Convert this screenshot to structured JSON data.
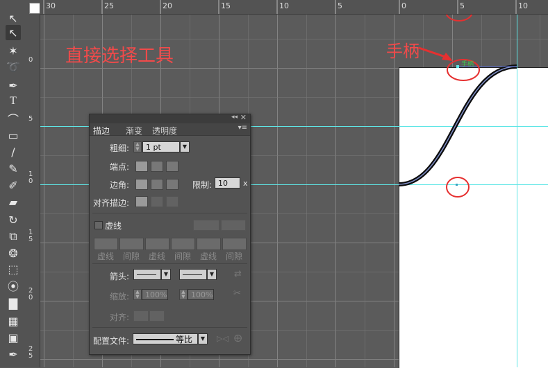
{
  "ruler": {
    "h_numbers": [
      "30",
      "25",
      "20",
      "15",
      "10",
      "5",
      "0",
      "5",
      "10"
    ],
    "v_numbers": [
      "0",
      "5",
      "1 0",
      "1 5",
      "2 0",
      "2 5"
    ]
  },
  "annotations": {
    "direct_select": "直接选择工具",
    "handle": "手柄",
    "handle_small": "手柄"
  },
  "stroke_panel": {
    "tabs": [
      "描边",
      "渐变",
      "透明度"
    ],
    "weight_label": "粗细:",
    "weight_value": "1 pt",
    "cap_label": "端点:",
    "corner_label": "边角:",
    "limit_label": "限制:",
    "limit_value": "10",
    "limit_unit": "x",
    "align_label": "对齐描边:",
    "dashed_label": "虚线",
    "dash_labels": [
      "虚线",
      "间隙",
      "虚线",
      "间隙",
      "虚线",
      "间隙"
    ],
    "arrow_label": "箭头:",
    "scale_label": "缩放:",
    "scale_start": "100%",
    "scale_end": "100%",
    "align_arrow_label": "对齐:",
    "profile_label": "配置文件:",
    "profile_value": "等比"
  },
  "colors": {
    "guide": "#5fe6e6",
    "annotation": "#f24a4a",
    "artboard": "#ffffff"
  }
}
